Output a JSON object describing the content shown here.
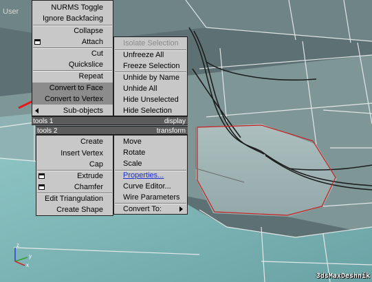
{
  "viewport": {
    "label": "User",
    "watermark": "3dsMaxDeshnik"
  },
  "left_menu": {
    "top": [
      "NURMS Toggle",
      "Ignore Backfacing"
    ],
    "group2": [
      "Collapse",
      "Attach"
    ],
    "group3": [
      "Cut",
      "Quickslice"
    ],
    "group4": [
      "Repeat",
      "Convert to Face",
      "Convert to Vertex",
      "Sub-objects"
    ],
    "tools1_label": "tools 1",
    "tools2_label": "tools 2",
    "bottom": [
      "Create",
      "Insert Vertex",
      "Cap",
      "Extrude",
      "Chamfer",
      "Edit Triangulation",
      "Create Shape"
    ]
  },
  "display_menu": {
    "top": [
      "Isolate Selection",
      "Unfreeze All",
      "Freeze Selection",
      "Unhide by Name",
      "Unhide All",
      "Hide Unselected",
      "Hide Selection"
    ],
    "header_label": "display"
  },
  "transform_menu": {
    "header_label": "transform",
    "group1": [
      "Move",
      "Rotate",
      "Scale"
    ],
    "group2": [
      "Properties...",
      "Curve Editor...",
      "Wire Parameters"
    ],
    "group3": [
      "Convert To:"
    ]
  },
  "axis": {
    "x": "x",
    "y": "y",
    "z": "z"
  },
  "colors": {
    "menu_bg": "#c8c8c8",
    "highlight": "#8c8c8c",
    "quad_header": "#5c5c5c",
    "link": "#1a2cd6",
    "pointer": "#e21a1a",
    "selection_outline": "#c81e1e"
  }
}
